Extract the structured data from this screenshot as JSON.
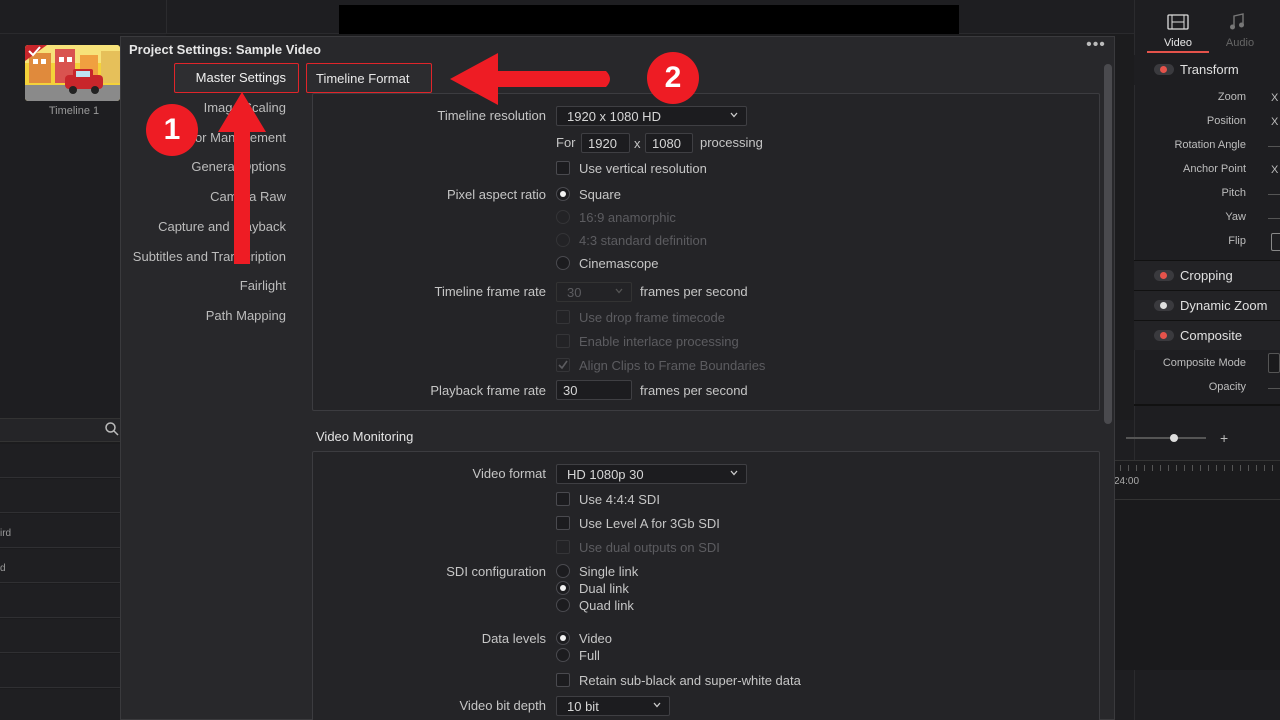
{
  "dialog": {
    "title": "Project Settings:  Sample Video",
    "menu_glyph": "•••"
  },
  "sidebar": {
    "items": [
      {
        "label": "Master Settings"
      },
      {
        "label": "Image Scaling"
      },
      {
        "label": "Color Management"
      },
      {
        "label": "General Options"
      },
      {
        "label": "Camera Raw"
      },
      {
        "label": "Capture and Playback"
      },
      {
        "label": "Subtitles and Transcription"
      },
      {
        "label": "Fairlight"
      },
      {
        "label": "Path Mapping"
      }
    ]
  },
  "timeline_format": {
    "title": "Timeline Format",
    "resolution_label": "Timeline resolution",
    "resolution_value": "1920 x 1080 HD",
    "for_label": "For",
    "width": "1920",
    "x_label": "x",
    "height": "1080",
    "processing_label": "processing",
    "vertical_label": "Use vertical resolution",
    "pixel_aspect_label": "Pixel aspect ratio",
    "aspect_options": [
      "Square",
      "16:9 anamorphic",
      "4:3 standard definition",
      "Cinemascope"
    ],
    "frame_rate_label": "Timeline frame rate",
    "frame_rate_value": "30",
    "fps_label": "frames per second",
    "drop_frame_label": "Use drop frame timecode",
    "interlace_label": "Enable interlace processing",
    "align_clips_label": "Align Clips to Frame Boundaries",
    "playback_rate_label": "Playback frame rate",
    "playback_rate_value": "30",
    "playback_fps_label": "frames per second"
  },
  "video_monitoring": {
    "title": "Video Monitoring",
    "format_label": "Video format",
    "format_value": "HD 1080p 30",
    "use444_label": "Use 4:4:4 SDI",
    "levelA_label": "Use Level A for 3Gb SDI",
    "dual_outputs_label": "Use dual outputs on SDI",
    "sdi_label": "SDI configuration",
    "sdi_options": [
      "Single link",
      "Dual link",
      "Quad link"
    ],
    "data_levels_label": "Data levels",
    "data_levels_options": [
      "Video",
      "Full"
    ],
    "retain_label": "Retain sub-black and super-white data",
    "bit_depth_label": "Video bit depth",
    "bit_depth_value": "10 bit"
  },
  "media_pool": {
    "clip_label": "Timeline 1",
    "row_labels": [
      "ird",
      "d"
    ]
  },
  "inspector": {
    "tabs": [
      "Video",
      "Audio"
    ],
    "transform": {
      "title": "Transform",
      "rows": [
        "Zoom",
        "Position",
        "Rotation Angle",
        "Anchor Point",
        "Pitch",
        "Yaw",
        "Flip"
      ],
      "x_glyph": "X"
    },
    "sections": [
      "Cropping",
      "Dynamic Zoom",
      "Composite"
    ],
    "composite_rows": [
      "Composite Mode",
      "Opacity"
    ]
  },
  "timeline": {
    "timecode": "24:00",
    "plus": "+"
  },
  "annotations": {
    "badge1": "1",
    "badge2": "2"
  },
  "colors": {
    "annotation_red": "#ee1c24",
    "highlight_red": "#e0252a",
    "dialog_bg": "#28282b"
  }
}
